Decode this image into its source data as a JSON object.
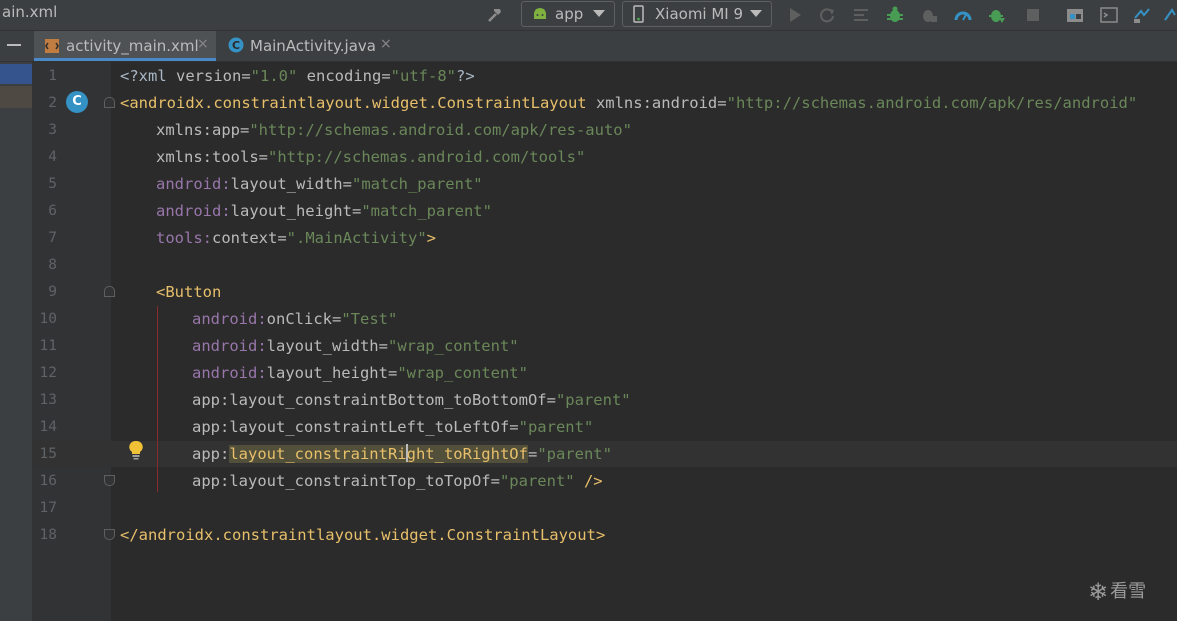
{
  "window": {
    "file_title": "ain.xml"
  },
  "toolbar": {
    "run_config": "app",
    "device": "Xiaomi MI 9",
    "icons": [
      "hammer-icon",
      "android-icon",
      "phone-icon",
      "run-icon",
      "rerun-icon",
      "coverage-icon",
      "debug-icon",
      "attach-icon",
      "profiler-icon",
      "apply-changes-icon",
      "stop-icon",
      "project-structure-icon",
      "terminal-icon",
      "sync-icon"
    ]
  },
  "tabs": [
    {
      "label": "activity_main.xml",
      "close": "×",
      "icon": "xml-file-icon"
    },
    {
      "label": "MainActivity.java",
      "close": "×",
      "icon": "java-class-icon"
    }
  ],
  "gutter": {
    "badge": "C"
  },
  "lines": [
    "1",
    "2",
    "3",
    "4",
    "5",
    "6",
    "7",
    "8",
    "9",
    "10",
    "11",
    "12",
    "13",
    "14",
    "15",
    "16",
    "17",
    "18"
  ],
  "code": {
    "l1": {
      "open": "<?xml ",
      "a1": "version=",
      "v1": "\"1.0\"",
      "a2": " encoding=",
      "v2": "\"utf-8\"",
      "close": "?>"
    },
    "l2": {
      "open": "<",
      "tag": "androidx.constraintlayout.widget.ConstraintLayout",
      "ns": " xmlns:android",
      "eq": "=",
      "val": "\"http://schemas.android.com/apk/res/android\""
    },
    "l3": {
      "ns": "xmlns:app",
      "eq": "=",
      "val": "\"http://schemas.android.com/apk/res-auto\""
    },
    "l4": {
      "ns": "xmlns:tools",
      "eq": "=",
      "val": "\"http://schemas.android.com/tools\""
    },
    "l5": {
      "ns": "android:",
      "attr": "layout_width",
      "eq": "=",
      "val": "\"match_parent\""
    },
    "l6": {
      "ns": "android:",
      "attr": "layout_height",
      "eq": "=",
      "val": "\"match_parent\""
    },
    "l7": {
      "ns": "tools:",
      "attr": "context",
      "eq": "=",
      "val": "\".MainActivity\"",
      "close": ">"
    },
    "l9": {
      "open": "<",
      "tag": "Button"
    },
    "l10": {
      "ns": "android:",
      "attr": "onClick",
      "eq": "=",
      "val": "\"Test\""
    },
    "l11": {
      "ns": "android:",
      "attr": "layout_width",
      "eq": "=",
      "val": "\"wrap_content\""
    },
    "l12": {
      "ns": "android:",
      "attr": "layout_height",
      "eq": "=",
      "val": "\"wrap_content\""
    },
    "l13": {
      "ns": "app:",
      "attr": "layout_constraintBottom_toBottomOf",
      "eq": "=",
      "val": "\"parent\""
    },
    "l14": {
      "ns": "app:",
      "attr": "layout_constraintLeft_toLeftOf",
      "eq": "=",
      "val": "\"parent\""
    },
    "l15": {
      "ns": "app:",
      "attr_a": "layout_constraintRi",
      "attr_b": "ght_toRightOf",
      "eq": "=",
      "val": "\"parent\""
    },
    "l16": {
      "ns": "app:",
      "attr": "layout_constraintTop_toTopOf",
      "eq": "=",
      "val": "\"parent\"",
      "close": " />"
    },
    "l18": {
      "open": "</",
      "tag": "androidx.constraintlayout.widget.ConstraintLayout",
      "close": ">"
    }
  },
  "watermark": {
    "flake": "❄",
    "text": "看雪"
  },
  "colors": {
    "background": "#2b2b2b",
    "tag": "#e8bf6a",
    "string": "#6a8759",
    "attribute": "#bababa",
    "badge": "#3592c4",
    "highlight": "#52503a"
  }
}
